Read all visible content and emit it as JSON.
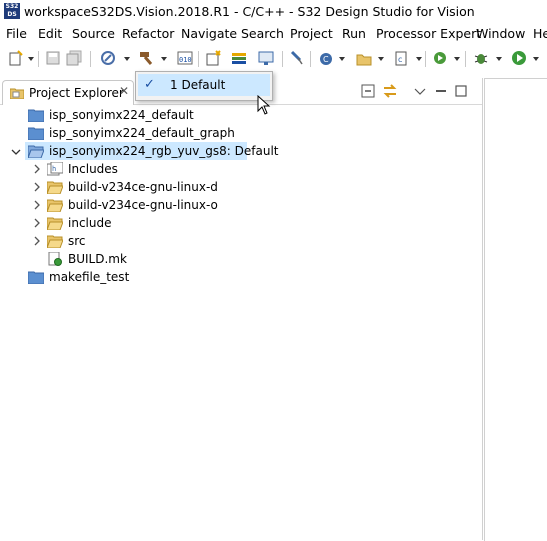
{
  "window": {
    "app_icon_text": "S32\nDS",
    "title": "workspaceS32DS.Vision.2018.R1 - C/C++ - S32 Design Studio for Vision"
  },
  "menu": [
    "File",
    "Edit",
    "Source",
    "Refactor",
    "Navigate",
    "Search",
    "Project",
    "Run",
    "Processor Expert",
    "Window",
    "He"
  ],
  "toolbar_icons": [
    "new-icon",
    "save-icon",
    "save-all-icon",
    "build-settings-icon",
    "build-hammer-icon",
    "binary-icon",
    "new-project-icon",
    "debug-tool-icon",
    "monitor-icon",
    "pin-icon",
    "new-class-icon",
    "new-source-folder-icon",
    "new-file-icon",
    "run-external-icon",
    "debug-bug-icon",
    "run-icon"
  ],
  "build_config_menu": {
    "items": [
      {
        "label": "1 Default",
        "checked": true
      }
    ]
  },
  "project_explorer": {
    "tab_label": "Project Explorer",
    "close_glyph": "✕",
    "tree": [
      {
        "label": "isp_sonyimx224_default",
        "icon": "project-folder-icon",
        "level": 0
      },
      {
        "label": "isp_sonyimx224_default_graph",
        "icon": "project-folder-icon",
        "level": 0
      },
      {
        "label": "isp_sonyimx224_rgb_yuv_gs8: Default",
        "icon": "open-project-icon",
        "level": 0,
        "expanded": true,
        "selected": true
      },
      {
        "label": "Includes",
        "icon": "includes-icon",
        "level": 1,
        "collapsed": true
      },
      {
        "label": "build-v234ce-gnu-linux-d",
        "icon": "folder-icon",
        "level": 1,
        "collapsed": true
      },
      {
        "label": "build-v234ce-gnu-linux-o",
        "icon": "folder-icon",
        "level": 1,
        "collapsed": true
      },
      {
        "label": "include",
        "icon": "folder-icon",
        "level": 1,
        "collapsed": true
      },
      {
        "label": "src",
        "icon": "folder-icon",
        "level": 1,
        "collapsed": true
      },
      {
        "label": "BUILD.mk",
        "icon": "makefile-icon",
        "level": 1
      },
      {
        "label": "makefile_test",
        "icon": "project-folder-icon",
        "level": 0
      }
    ]
  }
}
